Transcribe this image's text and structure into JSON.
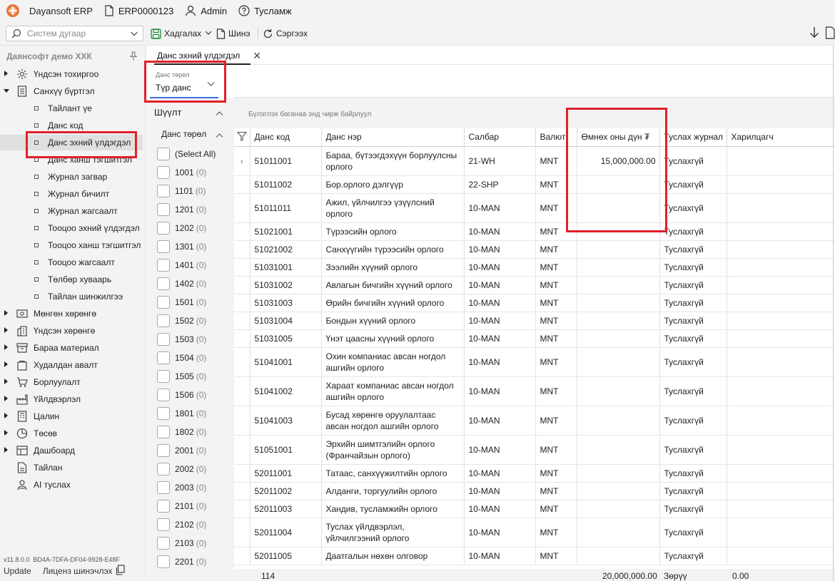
{
  "titlebar": {
    "app_name": "Dayansoft ERP",
    "system_code": "ERP0000123",
    "user": "Admin",
    "help": "Тусламж"
  },
  "toolbar": {
    "search_placeholder": "Систем дугаар",
    "save_label": "Хадгалах",
    "new_label": "Шинэ",
    "refresh_label": "Сэргээх"
  },
  "sidebar": {
    "org": "Даянсофт демо ХХК",
    "items": [
      {
        "label": "Үндсэн тохиргоо",
        "icon": "gear-icon",
        "state": "collapsed"
      },
      {
        "label": "Санхүү бүртгэл",
        "icon": "ledger-icon",
        "state": "expanded"
      },
      {
        "label": "Тайлант үе",
        "sub": true
      },
      {
        "label": "Данс код",
        "sub": true
      },
      {
        "label": "Данс эхний үлдэгдэл",
        "sub": true,
        "active": true
      },
      {
        "label": "Данс ханш тэгшитгэл",
        "sub": true
      },
      {
        "label": "Журнал загвар",
        "sub": true
      },
      {
        "label": "Журнал бичилт",
        "sub": true
      },
      {
        "label": "Журнал жагсаалт",
        "sub": true
      },
      {
        "label": "Тооцоо эхний үлдэгдэл",
        "sub": true
      },
      {
        "label": "Тооцоо ханш тэгшитгэл",
        "sub": true
      },
      {
        "label": "Тооцоо жагсаалт",
        "sub": true
      },
      {
        "label": "Төлбөр хуваарь",
        "sub": true
      },
      {
        "label": "Тайлан шинжилгээ",
        "sub": true
      },
      {
        "label": "Мөнгөн хөрөнгө",
        "icon": "money-icon",
        "state": "collapsed"
      },
      {
        "label": "Үндсэн хөрөнгө",
        "icon": "building-icon",
        "state": "collapsed"
      },
      {
        "label": "Бараа материал",
        "icon": "inventory-icon",
        "state": "collapsed"
      },
      {
        "label": "Худалдан авалт",
        "icon": "purchase-icon",
        "state": "collapsed"
      },
      {
        "label": "Борлуулалт",
        "icon": "sales-icon",
        "state": "collapsed"
      },
      {
        "label": "Үйлдвэрлэл",
        "icon": "factory-icon",
        "state": "collapsed"
      },
      {
        "label": "Цалин",
        "icon": "payroll-icon",
        "state": "collapsed"
      },
      {
        "label": "Төсөв",
        "icon": "budget-icon",
        "state": "collapsed"
      },
      {
        "label": "Дашбоард",
        "icon": "dashboard-icon",
        "state": "collapsed"
      },
      {
        "label": "Тайлан",
        "icon": "report-icon"
      },
      {
        "label": "AI туслах",
        "icon": "ai-icon"
      }
    ],
    "version": "v11.8.0.0",
    "license_key": "BD4A-7DFA-DF04-9928-E48F",
    "update_label": "Update",
    "license_label": "Лиценз шинэчлэх"
  },
  "tab": {
    "title": "Данс эхний үлдэгдэл"
  },
  "account_type": {
    "label": "Данс төрөл",
    "value": "Түр данс"
  },
  "filter": {
    "title": "Шүүлт",
    "group_title": "Данс төрөл",
    "select_all": "(Select All)",
    "options": [
      {
        "code": "1001",
        "count": "(0)"
      },
      {
        "code": "1101",
        "count": "(0)"
      },
      {
        "code": "1201",
        "count": "(0)"
      },
      {
        "code": "1202",
        "count": "(0)"
      },
      {
        "code": "1301",
        "count": "(0)"
      },
      {
        "code": "1401",
        "count": "(0)"
      },
      {
        "code": "1402",
        "count": "(0)"
      },
      {
        "code": "1501",
        "count": "(0)"
      },
      {
        "code": "1502",
        "count": "(0)"
      },
      {
        "code": "1503",
        "count": "(0)"
      },
      {
        "code": "1504",
        "count": "(0)"
      },
      {
        "code": "1505",
        "count": "(0)"
      },
      {
        "code": "1506",
        "count": "(0)"
      },
      {
        "code": "1801",
        "count": "(0)"
      },
      {
        "code": "1802",
        "count": "(0)"
      },
      {
        "code": "2001",
        "count": "(0)"
      },
      {
        "code": "2002",
        "count": "(0)"
      },
      {
        "code": "2003",
        "count": "(0)"
      },
      {
        "code": "2101",
        "count": "(0)"
      },
      {
        "code": "2102",
        "count": "(0)"
      },
      {
        "code": "2103",
        "count": "(0)"
      },
      {
        "code": "2201",
        "count": "(0)"
      }
    ]
  },
  "grid": {
    "group_hint": "Бүлэглэх баганаа энд чирж байрлуул",
    "columns": [
      "Данс код",
      "Данс нэр",
      "Салбар",
      "Валют",
      "Өмнөх оны дүн ₮",
      "Туслах журнал",
      "Харилцагч"
    ],
    "rows": [
      {
        "code": "51011001",
        "name": "Бараа, бүтээгдэхүүн борлуулсны орлого",
        "branch": "21-WH",
        "cur": "MNT",
        "amount": "15,000,000.00",
        "journal": "Туслахгүй",
        "partner": "",
        "tall": true
      },
      {
        "code": "51011002",
        "name": "Бор.орлого дэлгүүр",
        "branch": "22-SHP",
        "cur": "MNT",
        "amount": "",
        "journal": "Туслахгүй",
        "partner": ""
      },
      {
        "code": "51011011",
        "name": "Ажил, үйлчилгээ үзүүлсний орлого",
        "branch": "10-MAN",
        "cur": "MNT",
        "amount": "",
        "journal": "Туслахгүй",
        "partner": "",
        "tall": true
      },
      {
        "code": "51021001",
        "name": "Түрээсийн орлого",
        "branch": "10-MAN",
        "cur": "MNT",
        "amount": "",
        "journal": "Туслахгүй",
        "partner": ""
      },
      {
        "code": "51021002",
        "name": "Санхүүгийн түрээсийн орлого",
        "branch": "10-MAN",
        "cur": "MNT",
        "amount": "",
        "journal": "Туслахгүй",
        "partner": ""
      },
      {
        "code": "51031001",
        "name": "Зээлийн хүүний орлого",
        "branch": "10-MAN",
        "cur": "MNT",
        "amount": "",
        "journal": "Туслахгүй",
        "partner": ""
      },
      {
        "code": "51031002",
        "name": "Авлагын бичгийн хүүний орлого",
        "branch": "10-MAN",
        "cur": "MNT",
        "amount": "",
        "journal": "Туслахгүй",
        "partner": ""
      },
      {
        "code": "51031003",
        "name": "Өрийн бичгийн хүүний орлого",
        "branch": "10-MAN",
        "cur": "MNT",
        "amount": "",
        "journal": "Туслахгүй",
        "partner": ""
      },
      {
        "code": "51031004",
        "name": "Бондын хүүний орлого",
        "branch": "10-MAN",
        "cur": "MNT",
        "amount": "",
        "journal": "Туслахгүй",
        "partner": ""
      },
      {
        "code": "51031005",
        "name": "Үнэт цаасны хүүний орлого",
        "branch": "10-MAN",
        "cur": "MNT",
        "amount": "",
        "journal": "Туслахгүй",
        "partner": ""
      },
      {
        "code": "51041001",
        "name": "Охин компаниас авсан ногдол ашгийн орлого",
        "branch": "10-MAN",
        "cur": "MNT",
        "amount": "",
        "journal": "Туслахгүй",
        "partner": "",
        "tall": true
      },
      {
        "code": "51041002",
        "name": "Хараат компаниас авсан ногдол ашгийн орлого",
        "branch": "10-MAN",
        "cur": "MNT",
        "amount": "",
        "journal": "Туслахгүй",
        "partner": "",
        "tall": true
      },
      {
        "code": "51041003",
        "name": "Бусад хөрөнгө оруулалтаас авсан ногдол ашгийн орлого",
        "branch": "10-MAN",
        "cur": "MNT",
        "amount": "",
        "journal": "Туслахгүй",
        "partner": "",
        "tall": true
      },
      {
        "code": "51051001",
        "name": "Эрхийн шимтгэлийн орлого (Франчайзын орлого)",
        "branch": "10-MAN",
        "cur": "MNT",
        "amount": "",
        "journal": "Туслахгүй",
        "partner": "",
        "tall": true
      },
      {
        "code": "52011001",
        "name": "Татаас, санхүүжилтийн орлого",
        "branch": "10-MAN",
        "cur": "MNT",
        "amount": "",
        "journal": "Туслахгүй",
        "partner": ""
      },
      {
        "code": "52011002",
        "name": "Алданги, торгуулийн орлого",
        "branch": "10-MAN",
        "cur": "MNT",
        "amount": "",
        "journal": "Туслахгүй",
        "partner": ""
      },
      {
        "code": "52011003",
        "name": "Хандив, тусламжийн орлого",
        "branch": "10-MAN",
        "cur": "MNT",
        "amount": "",
        "journal": "Туслахгүй",
        "partner": ""
      },
      {
        "code": "52011004",
        "name": "Туслах үйлдвэрлэл, үйлчилгээний орлого",
        "branch": "10-MAN",
        "cur": "MNT",
        "amount": "",
        "journal": "Туслахгүй",
        "partner": "",
        "tall": true
      },
      {
        "code": "52011005",
        "name": "Даатгалын нөхөн олговор",
        "branch": "10-MAN",
        "cur": "MNT",
        "amount": "",
        "journal": "Туслахгүй",
        "partner": ""
      }
    ],
    "totals": {
      "count": "114",
      "amount": "20,000,000.00",
      "journal": "Зөрүү",
      "partner": "0.00"
    }
  },
  "colors": {
    "highlight": "#e0202a",
    "accent": "#3a6fd8"
  }
}
